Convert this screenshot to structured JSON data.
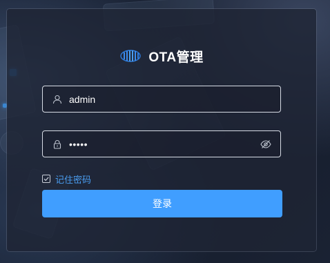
{
  "header": {
    "title": "OTA管理",
    "logo_icon": "ota-logo-icon"
  },
  "username": {
    "icon": "user-icon",
    "value": "admin"
  },
  "password": {
    "icon": "lock-icon",
    "masked_value": "•••••",
    "toggle_icon": "eye-icon"
  },
  "remember": {
    "label": "记住密码",
    "checked": true
  },
  "login_button": {
    "label": "登录"
  },
  "colors": {
    "accent": "#409eff",
    "link": "#4a9df0",
    "card_bg": "#1e2434",
    "text": "#ffffff"
  }
}
